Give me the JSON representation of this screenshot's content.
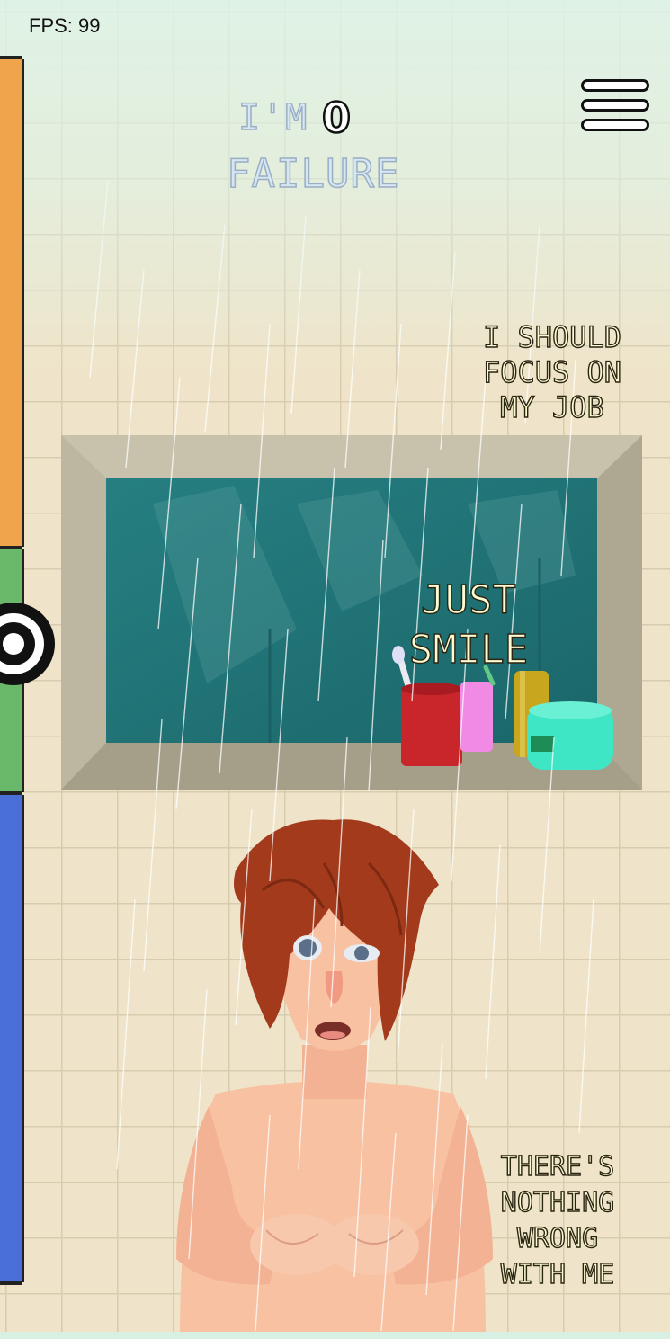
{
  "hud": {
    "fps_label": "FPS: 99"
  },
  "title": {
    "prefix": "I'M",
    "count": "0",
    "word": "FAILURE"
  },
  "thoughts": [
    {
      "id": "focus",
      "lines": [
        "I SHOULD",
        "FOCUS ON",
        "MY JOB"
      ]
    },
    {
      "id": "smile",
      "lines": [
        "JUST",
        "SMILE"
      ]
    },
    {
      "id": "wrong",
      "lines": [
        "THERE'S",
        "NOTHING",
        "WRONG",
        "WITH ME"
      ]
    }
  ],
  "meter": {
    "segments": [
      {
        "name": "orange-zone",
        "color": "#f0a44c"
      },
      {
        "name": "green-zone",
        "color": "#6ab96a"
      },
      {
        "name": "blue-zone",
        "color": "#4a6fd6"
      }
    ]
  },
  "icons": {
    "target": "target-icon",
    "menu": "hamburger-menu-icon"
  },
  "colors": {
    "tile": "#efe4c9",
    "grout": "#d8ccae",
    "window_glass": "#21777a",
    "hair": "#a23a1b",
    "skin": "#f7c1a2"
  }
}
